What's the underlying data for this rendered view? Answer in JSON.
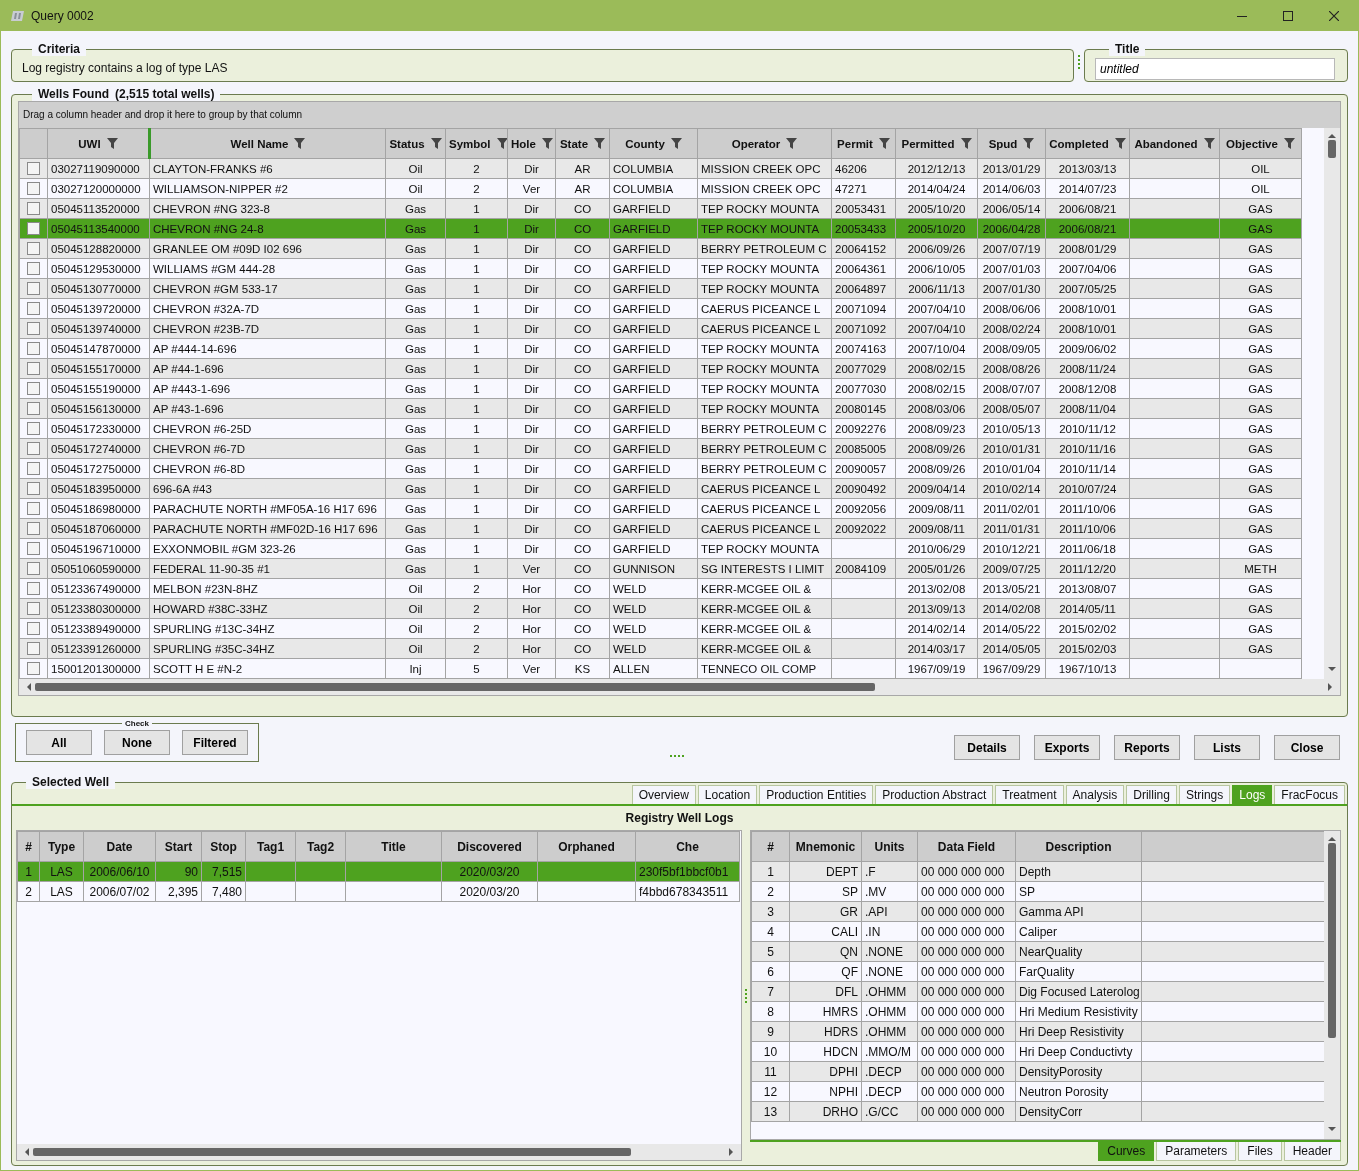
{
  "window": {
    "title": "Query 0002"
  },
  "criteria": {
    "label": "Criteria",
    "text": "Log registry contains a log of type LAS"
  },
  "title_box": {
    "label": "Title",
    "value": "untitled"
  },
  "wells_found": {
    "label": "Wells Found",
    "count": "(2,515 total wells)",
    "group_hint": "Drag a column header and drop it here to group by that column",
    "columns": [
      {
        "label": "UWI"
      },
      {
        "label": "Well Name"
      },
      {
        "label": "Status"
      },
      {
        "label": "Symbol"
      },
      {
        "label": "Hole"
      },
      {
        "label": "State"
      },
      {
        "label": "County"
      },
      {
        "label": "Operator"
      },
      {
        "label": "Permit"
      },
      {
        "label": "Permitted"
      },
      {
        "label": "Spud"
      },
      {
        "label": "Completed"
      },
      {
        "label": "Abandoned"
      },
      {
        "label": "Objective"
      }
    ],
    "rows": [
      {
        "checked": false,
        "selected": false,
        "cells": [
          "03027119090000",
          "CLAYTON-FRANKS #6",
          "Oil",
          "2",
          "Dir",
          "AR",
          "COLUMBIA",
          "MISSION CREEK OPC",
          "46206",
          "2012/12/13",
          "2013/01/29",
          "2013/03/13",
          null,
          "OIL"
        ]
      },
      {
        "checked": false,
        "selected": false,
        "cells": [
          "03027120000000",
          "WILLIAMSON-NIPPER #2",
          "Oil",
          "2",
          "Ver",
          "AR",
          "COLUMBIA",
          "MISSION CREEK OPC",
          "47271",
          "2014/04/24",
          "2014/06/03",
          "2014/07/23",
          null,
          "OIL"
        ]
      },
      {
        "checked": false,
        "selected": false,
        "cells": [
          "05045113520000",
          "CHEVRON #NG 323-8",
          "Gas",
          "1",
          "Dir",
          "CO",
          "GARFIELD",
          "TEP ROCKY MOUNTA",
          "20053431",
          "2005/10/20",
          "2006/05/14",
          "2006/08/21",
          null,
          "GAS"
        ]
      },
      {
        "checked": false,
        "selected": true,
        "cells": [
          "05045113540000",
          "CHEVRON #NG 24-8",
          "Gas",
          "1",
          "Dir",
          "CO",
          "GARFIELD",
          "TEP ROCKY MOUNTA",
          "20053433",
          "2005/10/20",
          "2006/04/28",
          "2006/08/21",
          null,
          "GAS"
        ]
      },
      {
        "checked": false,
        "selected": false,
        "cells": [
          "05045128820000",
          "GRANLEE OM #09D I02 696",
          "Gas",
          "1",
          "Dir",
          "CO",
          "GARFIELD",
          "BERRY PETROLEUM C",
          "20064152",
          "2006/09/26",
          "2007/07/19",
          "2008/01/29",
          null,
          "GAS"
        ]
      },
      {
        "checked": false,
        "selected": false,
        "cells": [
          "05045129530000",
          "WILLIAMS #GM 444-28",
          "Gas",
          "1",
          "Dir",
          "CO",
          "GARFIELD",
          "TEP ROCKY MOUNTA",
          "20064361",
          "2006/10/05",
          "2007/01/03",
          "2007/04/06",
          null,
          "GAS"
        ]
      },
      {
        "checked": false,
        "selected": false,
        "cells": [
          "05045130770000",
          "CHEVRON #GM 533-17",
          "Gas",
          "1",
          "Dir",
          "CO",
          "GARFIELD",
          "TEP ROCKY MOUNTA",
          "20064897",
          "2006/11/13",
          "2007/01/30",
          "2007/05/25",
          null,
          "GAS"
        ]
      },
      {
        "checked": false,
        "selected": false,
        "cells": [
          "05045139720000",
          "CHEVRON #32A-7D",
          "Gas",
          "1",
          "Dir",
          "CO",
          "GARFIELD",
          "CAERUS PICEANCE L",
          "20071094",
          "2007/04/10",
          "2008/06/06",
          "2008/10/01",
          null,
          "GAS"
        ]
      },
      {
        "checked": false,
        "selected": false,
        "cells": [
          "05045139740000",
          "CHEVRON #23B-7D",
          "Gas",
          "1",
          "Dir",
          "CO",
          "GARFIELD",
          "CAERUS PICEANCE L",
          "20071092",
          "2007/04/10",
          "2008/02/24",
          "2008/10/01",
          null,
          "GAS"
        ]
      },
      {
        "checked": false,
        "selected": false,
        "cells": [
          "05045147870000",
          "AP #444-14-696",
          "Gas",
          "1",
          "Dir",
          "CO",
          "GARFIELD",
          "TEP ROCKY MOUNTA",
          "20074163",
          "2007/10/04",
          "2008/09/05",
          "2009/06/02",
          null,
          "GAS"
        ]
      },
      {
        "checked": false,
        "selected": false,
        "cells": [
          "05045155170000",
          "AP #44-1-696",
          "Gas",
          "1",
          "Dir",
          "CO",
          "GARFIELD",
          "TEP ROCKY MOUNTA",
          "20077029",
          "2008/02/15",
          "2008/08/26",
          "2008/11/24",
          null,
          "GAS"
        ]
      },
      {
        "checked": false,
        "selected": false,
        "cells": [
          "05045155190000",
          "AP #443-1-696",
          "Gas",
          "1",
          "Dir",
          "CO",
          "GARFIELD",
          "TEP ROCKY MOUNTA",
          "20077030",
          "2008/02/15",
          "2008/07/07",
          "2008/12/08",
          null,
          "GAS"
        ]
      },
      {
        "checked": false,
        "selected": false,
        "cells": [
          "05045156130000",
          "AP #43-1-696",
          "Gas",
          "1",
          "Dir",
          "CO",
          "GARFIELD",
          "TEP ROCKY MOUNTA",
          "20080145",
          "2008/03/06",
          "2008/05/07",
          "2008/11/04",
          null,
          "GAS"
        ]
      },
      {
        "checked": false,
        "selected": false,
        "cells": [
          "05045172330000",
          "CHEVRON #6-25D",
          "Gas",
          "1",
          "Dir",
          "CO",
          "GARFIELD",
          "BERRY PETROLEUM C",
          "20092276",
          "2008/09/23",
          "2010/05/13",
          "2010/11/12",
          null,
          "GAS"
        ]
      },
      {
        "checked": false,
        "selected": false,
        "cells": [
          "05045172740000",
          "CHEVRON #6-7D",
          "Gas",
          "1",
          "Dir",
          "CO",
          "GARFIELD",
          "BERRY PETROLEUM C",
          "20085005",
          "2008/09/26",
          "2010/01/31",
          "2010/11/16",
          null,
          "GAS"
        ]
      },
      {
        "checked": false,
        "selected": false,
        "cells": [
          "05045172750000",
          "CHEVRON #6-8D",
          "Gas",
          "1",
          "Dir",
          "CO",
          "GARFIELD",
          "BERRY PETROLEUM C",
          "20090057",
          "2008/09/26",
          "2010/01/04",
          "2010/11/14",
          null,
          "GAS"
        ]
      },
      {
        "checked": false,
        "selected": false,
        "cells": [
          "05045183950000",
          "696-6A #43",
          "Gas",
          "1",
          "Dir",
          "CO",
          "GARFIELD",
          "CAERUS PICEANCE L",
          "20090492",
          "2009/04/14",
          "2010/02/14",
          "2010/07/24",
          null,
          "GAS"
        ]
      },
      {
        "checked": false,
        "selected": false,
        "cells": [
          "05045186980000",
          "PARACHUTE NORTH #MF05A-16 H17 696",
          "Gas",
          "1",
          "Dir",
          "CO",
          "GARFIELD",
          "CAERUS PICEANCE L",
          "20092056",
          "2009/08/11",
          "2011/02/01",
          "2011/10/06",
          null,
          "GAS"
        ]
      },
      {
        "checked": false,
        "selected": false,
        "cells": [
          "05045187060000",
          "PARACHUTE NORTH #MF02D-16 H17 696",
          "Gas",
          "1",
          "Dir",
          "CO",
          "GARFIELD",
          "CAERUS PICEANCE L",
          "20092022",
          "2009/08/11",
          "2011/01/31",
          "2011/10/06",
          null,
          "GAS"
        ]
      },
      {
        "checked": false,
        "selected": false,
        "cells": [
          "05045196710000",
          "EXXONMOBIL #GM 323-26",
          "Gas",
          "1",
          "Dir",
          "CO",
          "GARFIELD",
          "TEP ROCKY MOUNTA",
          null,
          "2010/06/29",
          "2010/12/21",
          "2011/06/18",
          null,
          "GAS"
        ]
      },
      {
        "checked": false,
        "selected": false,
        "cells": [
          "05051060590000",
          "FEDERAL 11-90-35 #1",
          "Gas",
          "1",
          "Ver",
          "CO",
          "GUNNISON",
          "SG INTERESTS I LIMIT",
          "20084109",
          "2005/01/26",
          "2009/07/25",
          "2011/12/20",
          null,
          "METH"
        ]
      },
      {
        "checked": false,
        "selected": false,
        "cells": [
          "05123367490000",
          "MELBON #23N-8HZ",
          "Oil",
          "2",
          "Hor",
          "CO",
          "WELD",
          "KERR-MCGEE OIL &",
          null,
          "2013/02/08",
          "2013/05/21",
          "2013/08/07",
          null,
          "GAS"
        ]
      },
      {
        "checked": false,
        "selected": false,
        "cells": [
          "05123380300000",
          "HOWARD #38C-33HZ",
          "Oil",
          "2",
          "Hor",
          "CO",
          "WELD",
          "KERR-MCGEE OIL &",
          null,
          "2013/09/13",
          "2014/02/08",
          "2014/05/11",
          null,
          "GAS"
        ]
      },
      {
        "checked": false,
        "selected": false,
        "cells": [
          "05123389490000",
          "SPURLING #13C-34HZ",
          "Oil",
          "2",
          "Hor",
          "CO",
          "WELD",
          "KERR-MCGEE OIL &",
          null,
          "2014/02/14",
          "2014/05/22",
          "2015/02/02",
          null,
          "GAS"
        ]
      },
      {
        "checked": false,
        "selected": false,
        "cells": [
          "05123391260000",
          "SPURLING #35C-34HZ",
          "Oil",
          "2",
          "Hor",
          "CO",
          "WELD",
          "KERR-MCGEE OIL &",
          null,
          "2014/03/17",
          "2014/05/05",
          "2015/02/03",
          null,
          "GAS"
        ]
      },
      {
        "checked": false,
        "selected": false,
        "cells": [
          "15001201300000",
          "SCOTT H E #N-2",
          "Inj",
          "5",
          "Ver",
          "KS",
          "ALLEN",
          "TENNECO OIL COMP",
          null,
          "1967/09/19",
          "1967/09/29",
          "1967/10/13",
          null,
          null
        ]
      }
    ]
  },
  "check": {
    "label": "Check",
    "buttons": [
      "All",
      "None",
      "Filtered"
    ]
  },
  "actions": [
    "Details",
    "Exports",
    "Reports",
    "Lists",
    "Close"
  ],
  "selected_well": {
    "label": "Selected Well",
    "tabs": [
      {
        "label": "Overview",
        "selected": false
      },
      {
        "label": "Location",
        "selected": false
      },
      {
        "label": "Production Entities",
        "selected": false
      },
      {
        "label": "Production Abstract",
        "selected": false
      },
      {
        "label": "Treatment",
        "selected": false
      },
      {
        "label": "Analysis",
        "selected": false
      },
      {
        "label": "Drilling",
        "selected": false
      },
      {
        "label": "Strings",
        "selected": false
      },
      {
        "label": "Logs",
        "selected": true
      },
      {
        "label": "FracFocus",
        "selected": false
      }
    ],
    "panel_title": "Registry Well Logs",
    "logs": {
      "columns": [
        {
          "label": "#"
        },
        {
          "label": "Type"
        },
        {
          "label": "Date"
        },
        {
          "label": "Start"
        },
        {
          "label": "Stop"
        },
        {
          "label": "Tag1"
        },
        {
          "label": "Tag2"
        },
        {
          "label": "Title"
        },
        {
          "label": "Discovered"
        },
        {
          "label": "Orphaned"
        },
        {
          "label": "Che"
        }
      ],
      "rows": [
        {
          "selected": true,
          "cells": [
            "1",
            "LAS",
            "2006/06/10",
            "90",
            "7,515",
            null,
            null,
            null,
            "2020/03/20",
            null,
            "230f5bf1bbcf0b1"
          ]
        },
        {
          "selected": false,
          "cells": [
            "2",
            "LAS",
            "2006/07/02",
            "2,395",
            "7,480",
            null,
            null,
            null,
            "2020/03/20",
            null,
            "f4bbd678343511"
          ]
        }
      ]
    },
    "curves": {
      "columns": [
        {
          "label": "#"
        },
        {
          "label": "Mnemonic"
        },
        {
          "label": "Units"
        },
        {
          "label": "Data Field"
        },
        {
          "label": "Description"
        }
      ],
      "rows": [
        {
          "selected": false,
          "cells": [
            "1",
            "DEPT",
            ".F",
            "00 000 000 000",
            "Depth"
          ]
        },
        {
          "selected": false,
          "cells": [
            "2",
            "SP",
            ".MV",
            "00 000 000 000",
            "SP"
          ]
        },
        {
          "selected": false,
          "cells": [
            "3",
            "GR",
            ".API",
            "00 000 000 000",
            "Gamma API"
          ]
        },
        {
          "selected": false,
          "cells": [
            "4",
            "CALI",
            ".IN",
            "00 000 000 000",
            "Caliper"
          ]
        },
        {
          "selected": false,
          "cells": [
            "5",
            "QN",
            ".NONE",
            "00 000 000 000",
            "NearQuality"
          ]
        },
        {
          "selected": false,
          "cells": [
            "6",
            "QF",
            ".NONE",
            "00 000 000 000",
            "FarQuality"
          ]
        },
        {
          "selected": false,
          "cells": [
            "7",
            "DFL",
            ".OHMM",
            "00 000 000 000",
            "Dig Focused Laterolog"
          ]
        },
        {
          "selected": false,
          "cells": [
            "8",
            "HMRS",
            ".OHMM",
            "00 000 000 000",
            "Hri Medium Resistivity"
          ]
        },
        {
          "selected": false,
          "cells": [
            "9",
            "HDRS",
            ".OHMM",
            "00 000 000 000",
            "Hri Deep Resistivity"
          ]
        },
        {
          "selected": false,
          "cells": [
            "10",
            "HDCN",
            ".MMO/M",
            "00 000 000 000",
            "Hri Deep Conductivty"
          ]
        },
        {
          "selected": false,
          "cells": [
            "11",
            "DPHI",
            ".DECP",
            "00 000 000 000",
            "DensityPorosity"
          ]
        },
        {
          "selected": false,
          "cells": [
            "12",
            "NPHI",
            ".DECP",
            "00 000 000 000",
            "Neutron Porosity"
          ]
        },
        {
          "selected": false,
          "cells": [
            "13",
            "DRHO",
            ".G/CC",
            "00 000 000 000",
            "DensityCorr"
          ]
        }
      ]
    },
    "curve_tabs": [
      {
        "label": "Curves",
        "selected": true
      },
      {
        "label": "Parameters",
        "selected": false
      },
      {
        "label": "Files",
        "selected": false
      },
      {
        "label": "Header",
        "selected": false
      }
    ]
  }
}
